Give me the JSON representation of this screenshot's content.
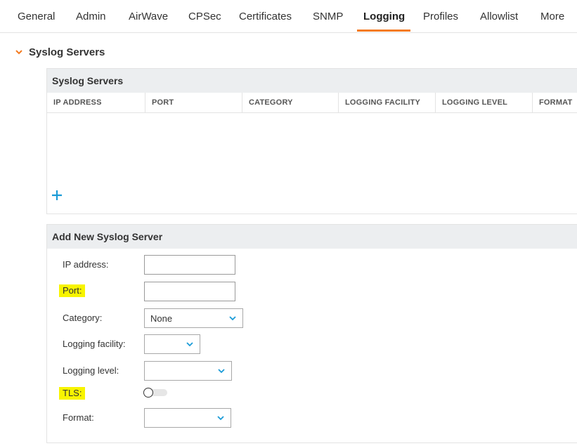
{
  "tabs": [
    {
      "label": "General"
    },
    {
      "label": "Admin"
    },
    {
      "label": "AirWave"
    },
    {
      "label": "CPSec"
    },
    {
      "label": "Certificates"
    },
    {
      "label": "SNMP"
    },
    {
      "label": "Logging",
      "active": true
    },
    {
      "label": "Profiles"
    },
    {
      "label": "Allowlist"
    },
    {
      "label": "More"
    }
  ],
  "section": {
    "title": "Syslog Servers",
    "expanded": true
  },
  "servers_table": {
    "title": "Syslog Servers",
    "columns": [
      "IP ADDRESS",
      "PORT",
      "CATEGORY",
      "LOGGING FACILITY",
      "LOGGING LEVEL",
      "FORMAT"
    ],
    "rows": []
  },
  "add_form": {
    "title": "Add New Syslog Server",
    "ip_label": "IP address:",
    "ip_value": "",
    "port_label": "Port:",
    "port_value": "",
    "category_label": "Category:",
    "category_value": "None",
    "facility_label": "Logging facility:",
    "facility_value": "",
    "level_label": "Logging level:",
    "level_value": "",
    "tls_label": "TLS:",
    "tls_on": false,
    "format_label": "Format:",
    "format_value": ""
  },
  "colors": {
    "accent": "#f47b20",
    "icon": "#1a9bd7",
    "highlight": "#f8f400",
    "panel_header": "#eceef0"
  }
}
